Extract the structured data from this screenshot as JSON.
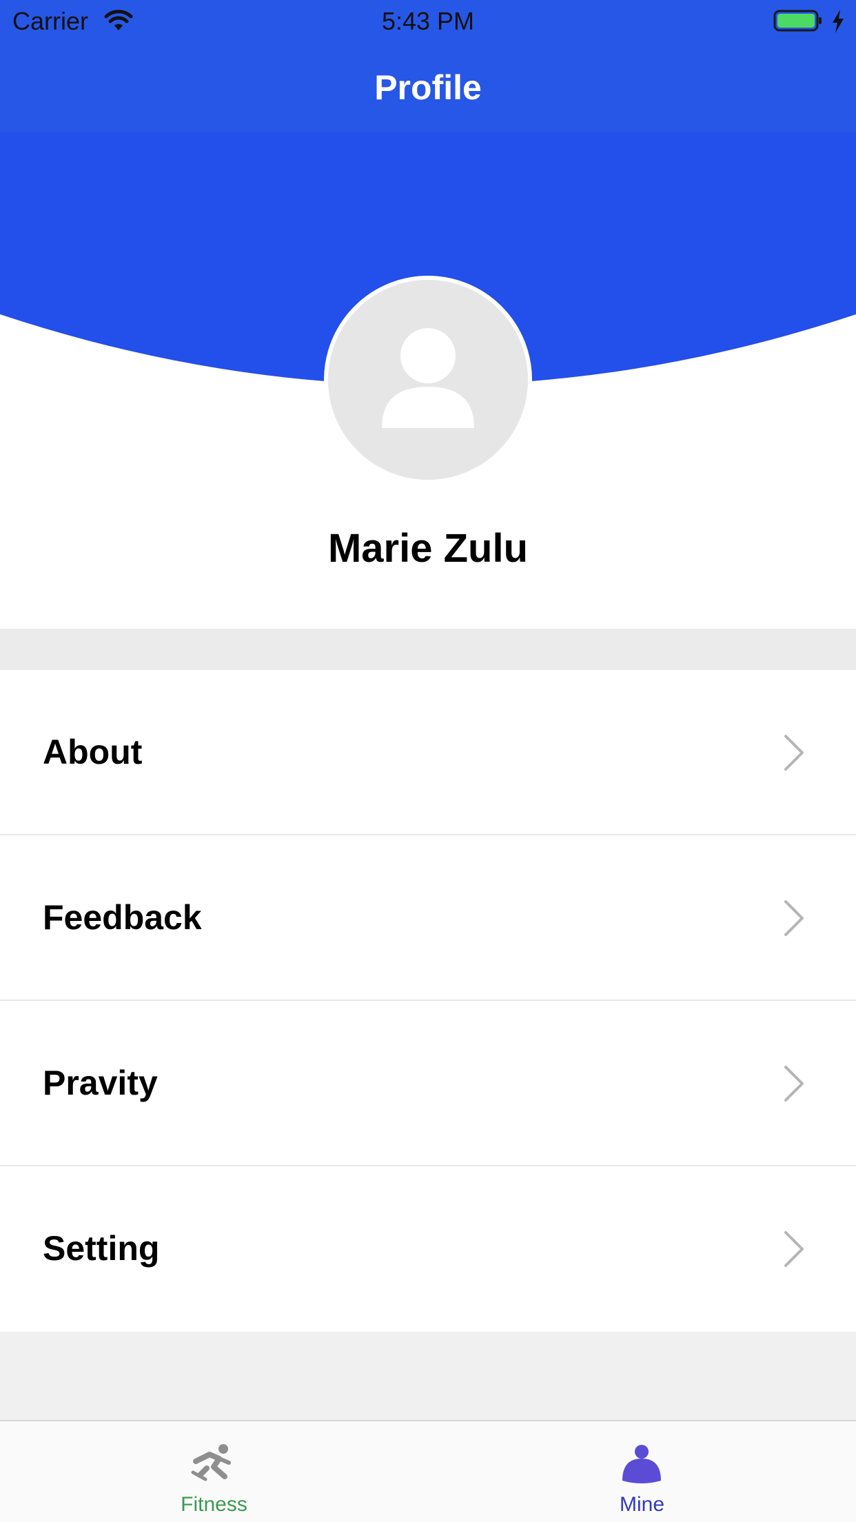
{
  "status_bar": {
    "carrier": "Carrier",
    "time": "5:43 PM",
    "icons": [
      "wifi-icon",
      "battery-icon",
      "charging-bolt-icon"
    ]
  },
  "nav": {
    "title": "Profile"
  },
  "profile": {
    "name": "Marie Zulu",
    "avatar_icon": "default-user-avatar-icon"
  },
  "menu": {
    "items": [
      {
        "label": "About",
        "icon": "chevron-right-icon"
      },
      {
        "label": "Feedback",
        "icon": "chevron-right-icon"
      },
      {
        "label": "Pravity",
        "icon": "chevron-right-icon"
      },
      {
        "label": "Setting",
        "icon": "chevron-right-icon"
      }
    ]
  },
  "tab_bar": {
    "tabs": [
      {
        "label": "Fitness",
        "icon": "fitness-runner-icon",
        "selected": false
      },
      {
        "label": "Mine",
        "icon": "person-icon",
        "selected": true
      }
    ]
  },
  "colors": {
    "primary_blue": "#2757e6",
    "header_blue": "#234fea",
    "fitness_green": "#3a9a52",
    "mine_indigo": "#3338b8",
    "mine_icon_purple": "#5b4cd6"
  }
}
